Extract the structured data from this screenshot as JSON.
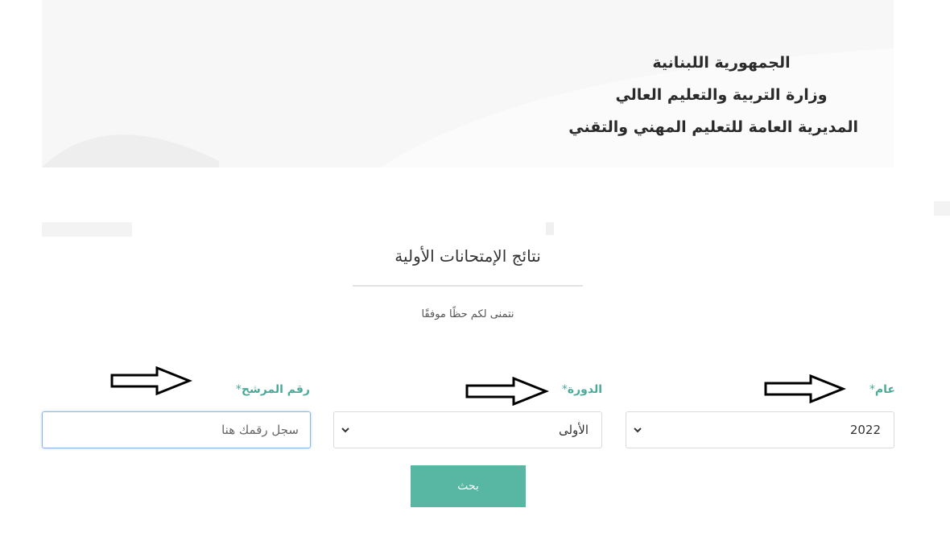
{
  "header": {
    "line1": "الجمهورية اللبنانية",
    "line2": "وزارة التربية والتعليم العالي",
    "line3": "المديرية العامة للتعليم المهني والتقني"
  },
  "form": {
    "title": "نتائج الإمتحانات الأولية",
    "subtitle": "نتمنى لكم حظًا موفقًا",
    "year": {
      "label": "عام",
      "required_mark": "*",
      "selected": "2022"
    },
    "session": {
      "label": "الدورة",
      "required_mark": "*",
      "selected": "الأولى"
    },
    "candidate_number": {
      "label": "رقم المرشح",
      "required_mark": "*",
      "placeholder": "سجل رقمك هنا",
      "value": ""
    },
    "search_button": "بحث"
  },
  "icons": {
    "dropdown": "chevron-down-icon",
    "annotation": "right-arrow-icon"
  },
  "colors": {
    "accent": "#58b7a3",
    "label": "#4aaa98",
    "focus_border": "#8ab6e8"
  }
}
